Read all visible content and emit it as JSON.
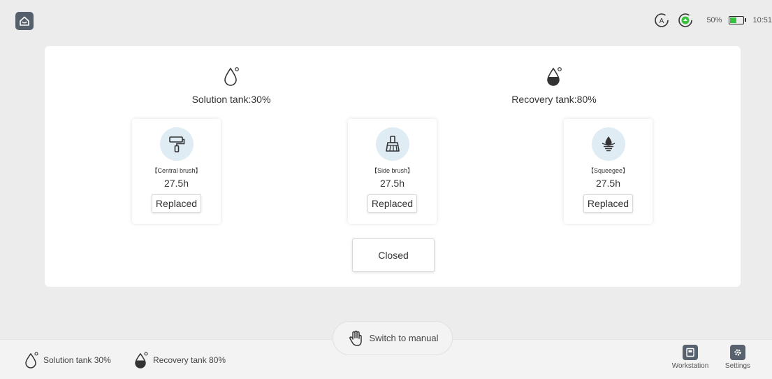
{
  "status": {
    "battery_percent": "50%",
    "battery_level": 0.5,
    "time": "10:51"
  },
  "panel": {
    "solution_tank_label": "Solution tank:30%",
    "recovery_tank_label": "Recovery tank:80%",
    "cards": [
      {
        "name": "【Central brush】",
        "hours": "27.5h",
        "button": "Replaced",
        "icon": "paint-roller-icon"
      },
      {
        "name": "【Side brush】",
        "hours": "27.5h",
        "button": "Replaced",
        "icon": "broom-icon"
      },
      {
        "name": "【Squeegee】",
        "hours": "27.5h",
        "button": "Replaced",
        "icon": "water-drop-icon"
      }
    ],
    "close_button": "Closed"
  },
  "bottom": {
    "manual_button": "Switch to manual",
    "solution_tank": "Solution tank 30%",
    "recovery_tank": "Recovery tank 80%",
    "workstation": "Workstation",
    "settings": "Settings"
  }
}
